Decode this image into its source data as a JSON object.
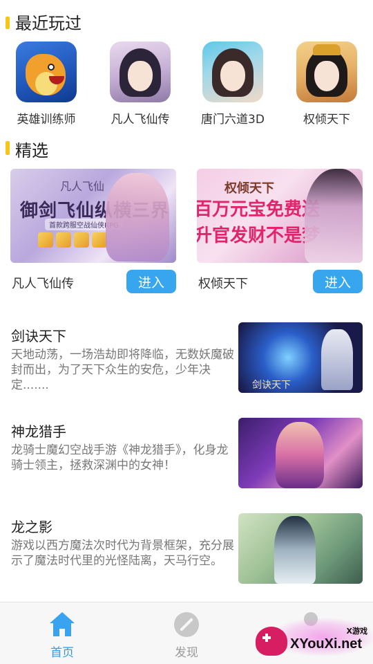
{
  "top_section": {
    "title": "最近玩过"
  },
  "apps": [
    {
      "label": "英雄训练师",
      "icon": "dragon-game-icon"
    },
    {
      "label": "凡人飞仙传",
      "icon": "fairy-game-icon"
    },
    {
      "label": "唐门六道3D",
      "icon": "heroine-game-icon"
    },
    {
      "label": "权倾天下",
      "icon": "empress-game-icon"
    }
  ],
  "featured_section": {
    "title": "精选"
  },
  "featured": [
    {
      "name": "凡人飞仙传",
      "button": "进入",
      "banner": {
        "logo": "凡人飞仙",
        "headline": "御剑飞仙纵横三界",
        "subline": "首款跨服空战仙侠RPG"
      }
    },
    {
      "name": "权倾天下",
      "button": "进入",
      "banner": {
        "logo": "权倾天下",
        "line1": "百万元宝免费送",
        "line2": "升官发财不是梦"
      }
    }
  ],
  "news": [
    {
      "title": "剑诀天下",
      "desc": "天地动荡，一场浩劫即将降临，无数妖魔破封而出，为了天下众生的安危，少年决定.......",
      "thumb_text": "剑诀天下"
    },
    {
      "title": "神龙猎手",
      "desc": "龙骑士魔幻空战手游《神龙猎手》，化身龙骑士领主，拯救深渊中的女神！"
    },
    {
      "title": "龙之影",
      "desc": "游戏以西方魔法次时代为背景框架，充分展示了魔法时代里的光怪陆离，天马行空。"
    }
  ],
  "bottom_nav": {
    "home": "首页",
    "discover": "发现"
  },
  "watermark": {
    "small": "X游戏",
    "text": "XYouXi.net"
  },
  "colors": {
    "accent": "#37a6ef",
    "section_bar": "#f5c518"
  }
}
